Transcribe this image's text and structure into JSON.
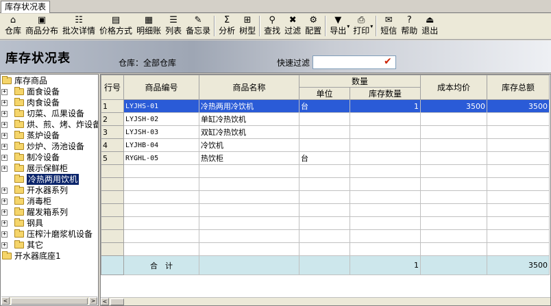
{
  "tab": {
    "label": "库存状况表"
  },
  "toolbar": {
    "buttons": [
      {
        "label": "仓库",
        "icon": "⌂"
      },
      {
        "label": "商品分布",
        "icon": "▣"
      },
      {
        "label": "批次详情",
        "icon": "☷"
      },
      {
        "label": "价格方式",
        "icon": "▤"
      },
      {
        "label": "明细账",
        "icon": "▦"
      },
      {
        "label": "列表",
        "icon": "☰"
      },
      {
        "label": "备忘录",
        "icon": "✎"
      },
      {
        "label": "分析",
        "icon": "Σ"
      },
      {
        "label": "树型",
        "icon": "⊞"
      },
      {
        "label": "查找",
        "icon": "⚲"
      },
      {
        "label": "过滤",
        "icon": "✖"
      },
      {
        "label": "配置",
        "icon": "⚙"
      },
      {
        "label": "导出",
        "icon": "▼"
      },
      {
        "label": "打印",
        "icon": "⎙"
      },
      {
        "label": "短信",
        "icon": "✉"
      },
      {
        "label": "帮助",
        "icon": "?"
      },
      {
        "label": "退出",
        "icon": "⏏"
      }
    ]
  },
  "header": {
    "title": "库存状况表",
    "warehouse": "仓库：全部仓库",
    "filter_label": "快速过滤",
    "filter_value": ""
  },
  "tree": {
    "root": "库存商品",
    "items": [
      "面食设备",
      "肉食设备",
      "切菜、瓜果设备",
      "烘、煎、烤、炸设备",
      "蒸炉设备",
      "炒炉、汤池设备",
      "制冷设备",
      "展示保鲜柜",
      "冷热两用饮机",
      "开水器系列",
      "消毒柜",
      "醒发箱系列",
      "钢具",
      "压榨汁磨浆机设备",
      "其它"
    ],
    "selected": "冷热两用饮机",
    "bottom": "开水器底座1"
  },
  "grid": {
    "headers": {
      "rownum": "行号",
      "code": "商品编号",
      "name": "商品名称",
      "qty_group": "数量",
      "unit": "单位",
      "stock_qty": "库存数量",
      "avg_cost": "成本均价",
      "total": "库存总额"
    },
    "rows": [
      {
        "rn": "1",
        "code": "LYJHS-01",
        "name": "冷热两用冷饮机",
        "unit": "台",
        "qty": "1",
        "cost": "3500",
        "total": "3500"
      },
      {
        "rn": "2",
        "code": "LYJSH-02",
        "name": "单缸冷热饮机",
        "unit": "",
        "qty": "",
        "cost": "",
        "total": ""
      },
      {
        "rn": "3",
        "code": "LYJSH-03",
        "name": "双缸冷热饮机",
        "unit": "",
        "qty": "",
        "cost": "",
        "total": ""
      },
      {
        "rn": "4",
        "code": "LYJHB-04",
        "name": "冷饮机",
        "unit": "",
        "qty": "",
        "cost": "",
        "total": ""
      },
      {
        "rn": "5",
        "code": "RYGHL-05",
        "name": "热饮柜",
        "unit": "台",
        "qty": "",
        "cost": "",
        "total": ""
      }
    ],
    "footer": {
      "label": "合　计",
      "qty": "1",
      "total": "3500"
    }
  }
}
